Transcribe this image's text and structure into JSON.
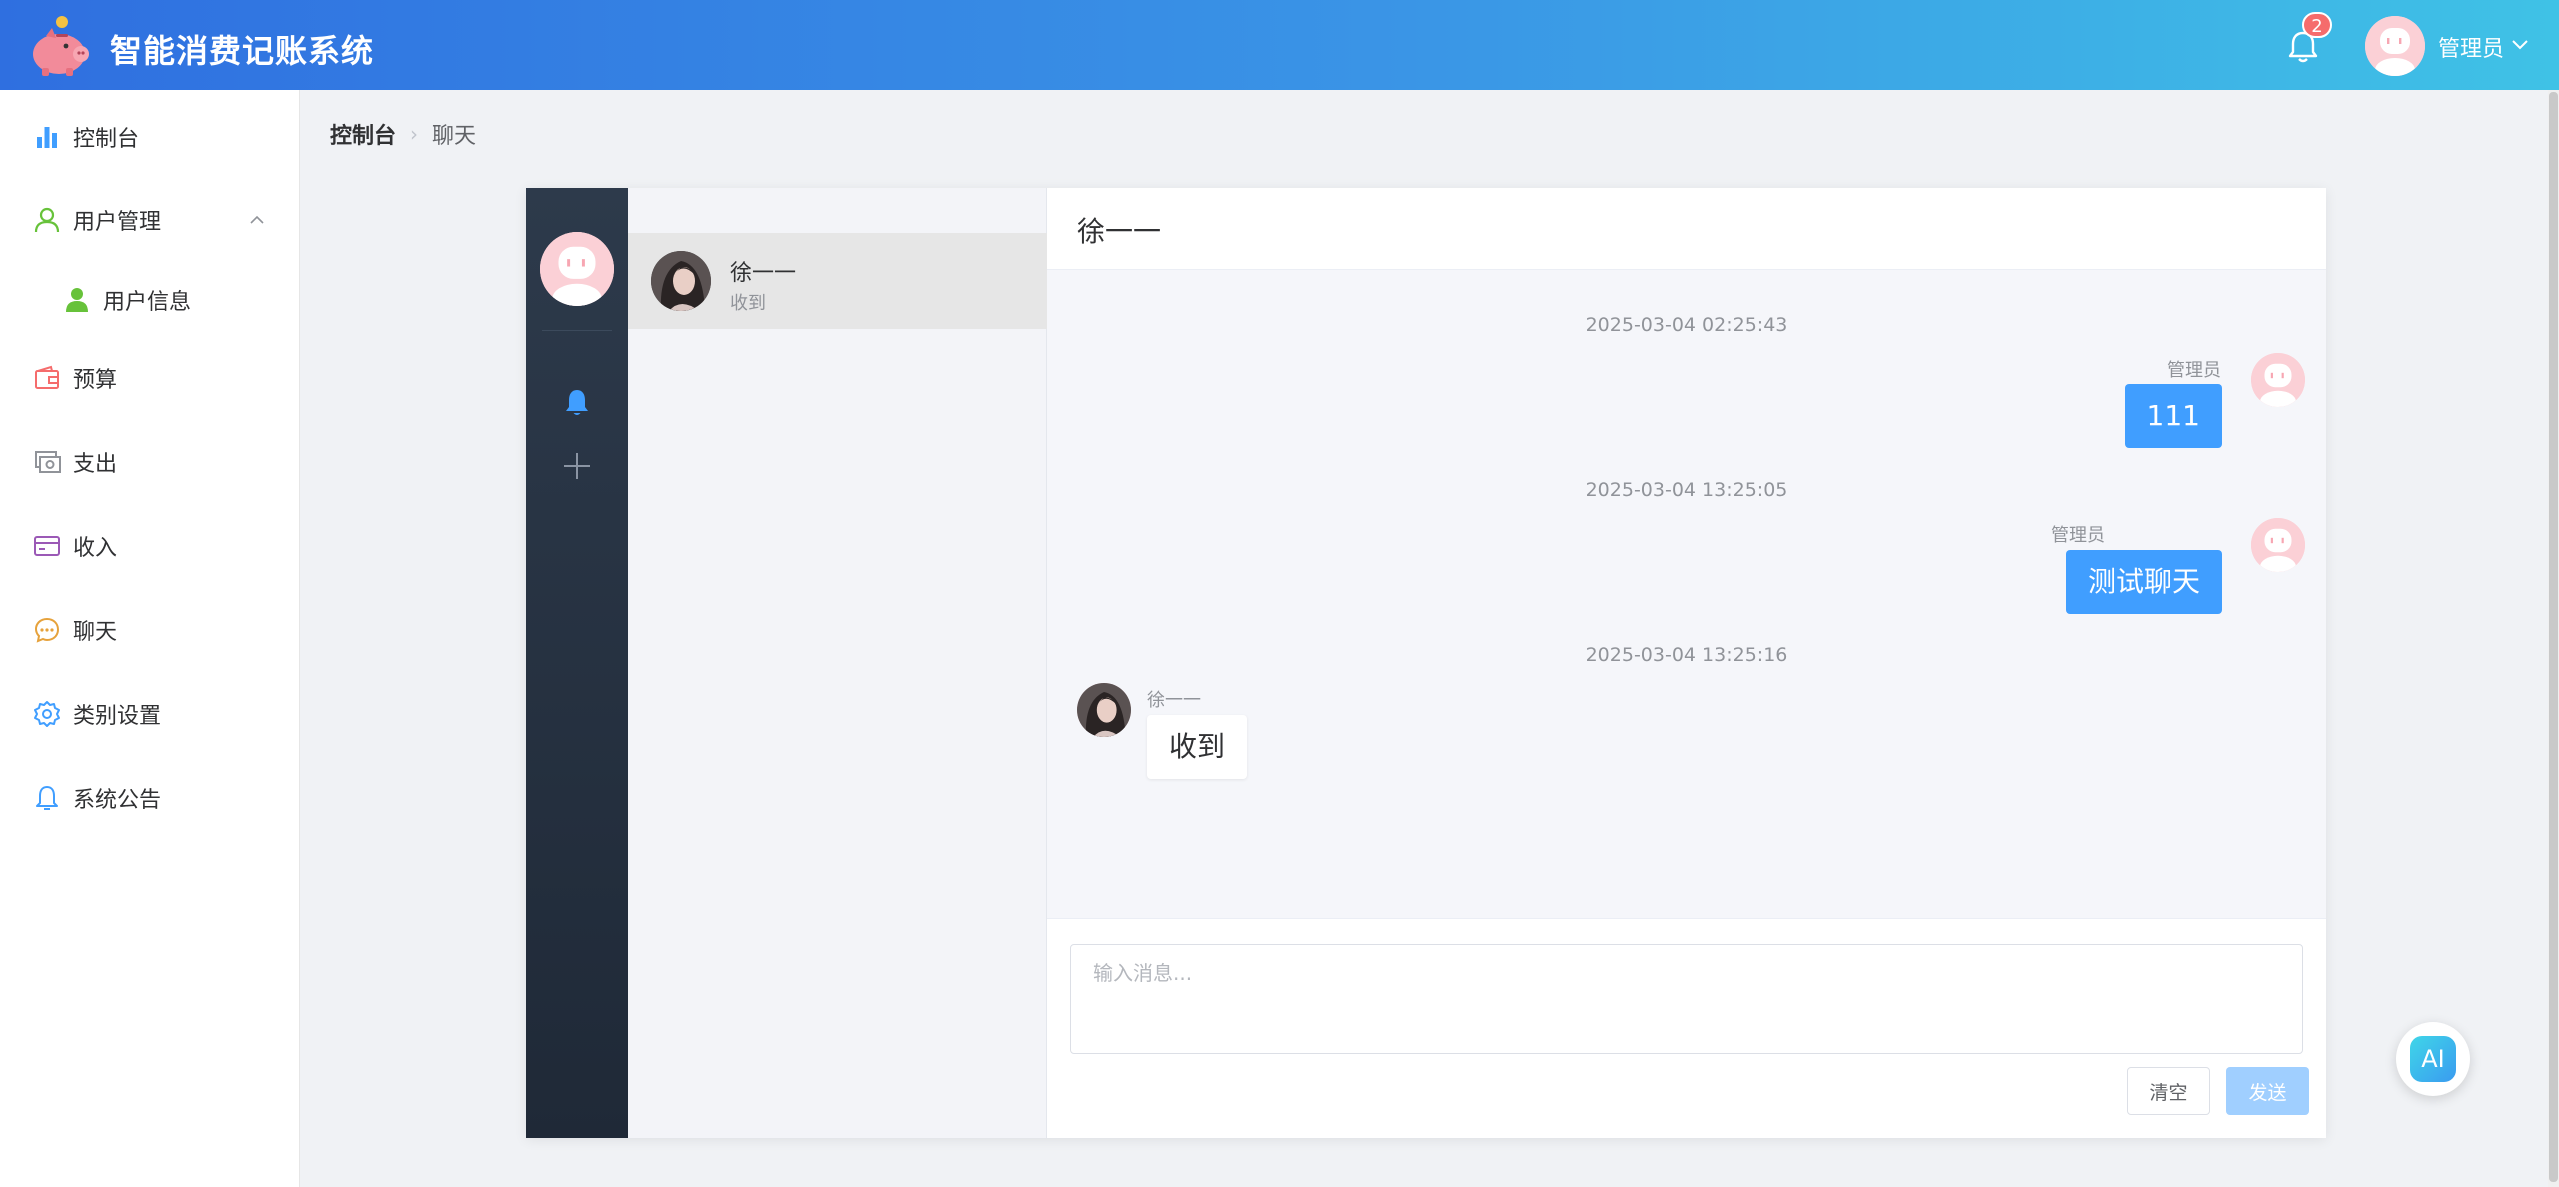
{
  "header": {
    "title": "智能消费记账系统",
    "notification_count": "2",
    "username": "管理员"
  },
  "sidebar": {
    "items": [
      {
        "label": "控制台",
        "icon": "bar-chart-icon"
      },
      {
        "label": "用户管理",
        "icon": "user-icon"
      },
      {
        "label": "用户信息",
        "icon": "user-filled-icon"
      },
      {
        "label": "预算",
        "icon": "wallet-icon"
      },
      {
        "label": "支出",
        "icon": "money-icon"
      },
      {
        "label": "收入",
        "icon": "credit-card-icon"
      },
      {
        "label": "聊天",
        "icon": "chat-dots-icon"
      },
      {
        "label": "类别设置",
        "icon": "settings-icon"
      },
      {
        "label": "系统公告",
        "icon": "bell-icon"
      }
    ]
  },
  "breadcrumb": {
    "home": "控制台",
    "current": "聊天"
  },
  "chat": {
    "conversation": {
      "name": "徐一一",
      "last_message": "收到"
    },
    "header_title": "徐一一",
    "messages": [
      {
        "timestamp": "2025-03-04 02:25:43",
        "sender": "管理员",
        "text": "111",
        "self": true
      },
      {
        "timestamp": "2025-03-04 13:25:05",
        "sender": "管理员",
        "text": "测试聊天",
        "self": true
      },
      {
        "timestamp": "2025-03-04 13:25:16",
        "sender": "徐一一",
        "text": "收到",
        "self": false
      }
    ],
    "input_placeholder": "输入消息...",
    "clear_label": "清空",
    "send_label": "发送"
  },
  "ai_button": {
    "label": "AI"
  },
  "colors": {
    "accent": "#409eff",
    "header_start": "#2f6fe0",
    "header_end": "#3fc2e6",
    "dark_bar": "#2d3a4b",
    "badge": "#f56c6c"
  }
}
